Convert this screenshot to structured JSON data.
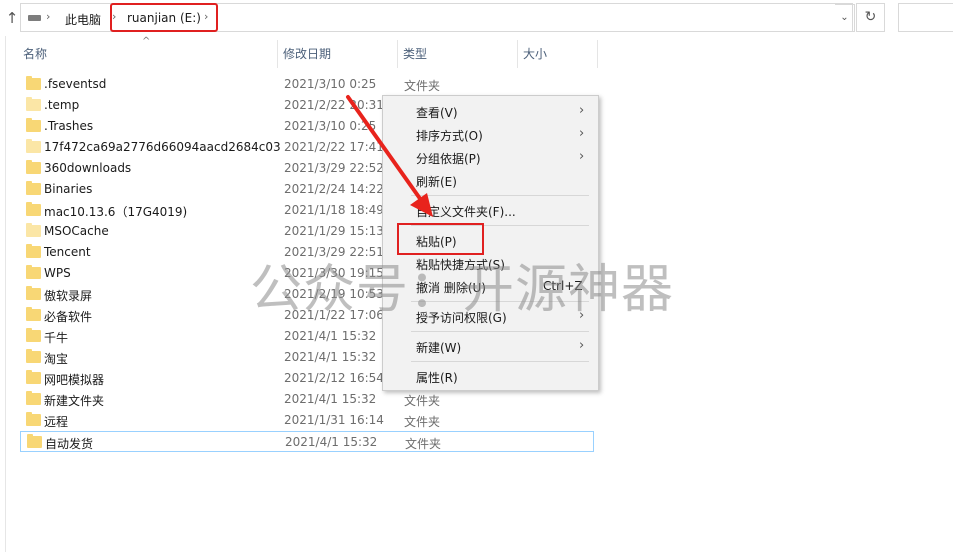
{
  "address": {
    "crumbs": [
      "此电脑",
      "ruanjian (E:)"
    ],
    "chevron": "›",
    "dropdown_icon": "chevron-down-icon",
    "refresh_icon": "refresh-icon"
  },
  "columns": {
    "name": "名称",
    "date": "修改日期",
    "type": "类型",
    "size": "大小"
  },
  "files": [
    {
      "name": ".fseventsd",
      "date": "2021/3/10 0:25",
      "type": "文件夹"
    },
    {
      "name": ".temp",
      "date": "2021/2/22 20:31",
      "type": ""
    },
    {
      "name": ".Trashes",
      "date": "2021/3/10 0:25",
      "type": ""
    },
    {
      "name": "17f472ca69a2776d66094aacd2684c03",
      "date": "2021/2/22 17:41",
      "type": ""
    },
    {
      "name": "360downloads",
      "date": "2021/3/29 22:52",
      "type": ""
    },
    {
      "name": "Binaries",
      "date": "2021/2/24 14:22",
      "type": ""
    },
    {
      "name": "mac10.13.6（17G4019)",
      "date": "2021/1/18 18:49",
      "type": ""
    },
    {
      "name": "MSOCache",
      "date": "2021/1/29 15:13",
      "type": ""
    },
    {
      "name": "Tencent",
      "date": "2021/3/29 22:51",
      "type": ""
    },
    {
      "name": "WPS",
      "date": "2021/3/30 19:15",
      "type": ""
    },
    {
      "name": "傲软录屏",
      "date": "2021/2/19 10:53",
      "type": ""
    },
    {
      "name": "必备软件",
      "date": "2021/1/22 17:06",
      "type": ""
    },
    {
      "name": "千牛",
      "date": "2021/4/1 15:32",
      "type": ""
    },
    {
      "name": "淘宝",
      "date": "2021/4/1 15:32",
      "type": ""
    },
    {
      "name": "网吧模拟器",
      "date": "2021/2/12 16:54",
      "type": ""
    },
    {
      "name": "新建文件夹",
      "date": "2021/4/1 15:32",
      "type": "文件夹"
    },
    {
      "name": "远程",
      "date": "2021/1/31 16:14",
      "type": "文件夹"
    },
    {
      "name": "自动发货",
      "date": "2021/4/1 15:32",
      "type": "文件夹"
    }
  ],
  "context_menu": {
    "items": [
      {
        "label": "查看(V)",
        "submenu": true
      },
      {
        "label": "排序方式(O)",
        "submenu": true
      },
      {
        "label": "分组依据(P)",
        "submenu": true
      },
      {
        "label": "刷新(E)"
      },
      {
        "label": "自定义文件夹(F)..."
      },
      {
        "label": "粘贴(P)"
      },
      {
        "label": "粘贴快捷方式(S)"
      },
      {
        "label": "撤消 删除(U)",
        "shortcut": "Ctrl+Z"
      },
      {
        "label": "授予访问权限(G)",
        "submenu": true
      },
      {
        "label": "新建(W)",
        "submenu": true
      },
      {
        "label": "属性(R)"
      }
    ],
    "submenu_arrow": "›"
  },
  "watermark": "公众号：开源神器",
  "colors": {
    "highlight": "#e02020",
    "folder": "#f8d775",
    "menu_bg": "#f2f2f2",
    "selection": "#99d1ff"
  }
}
